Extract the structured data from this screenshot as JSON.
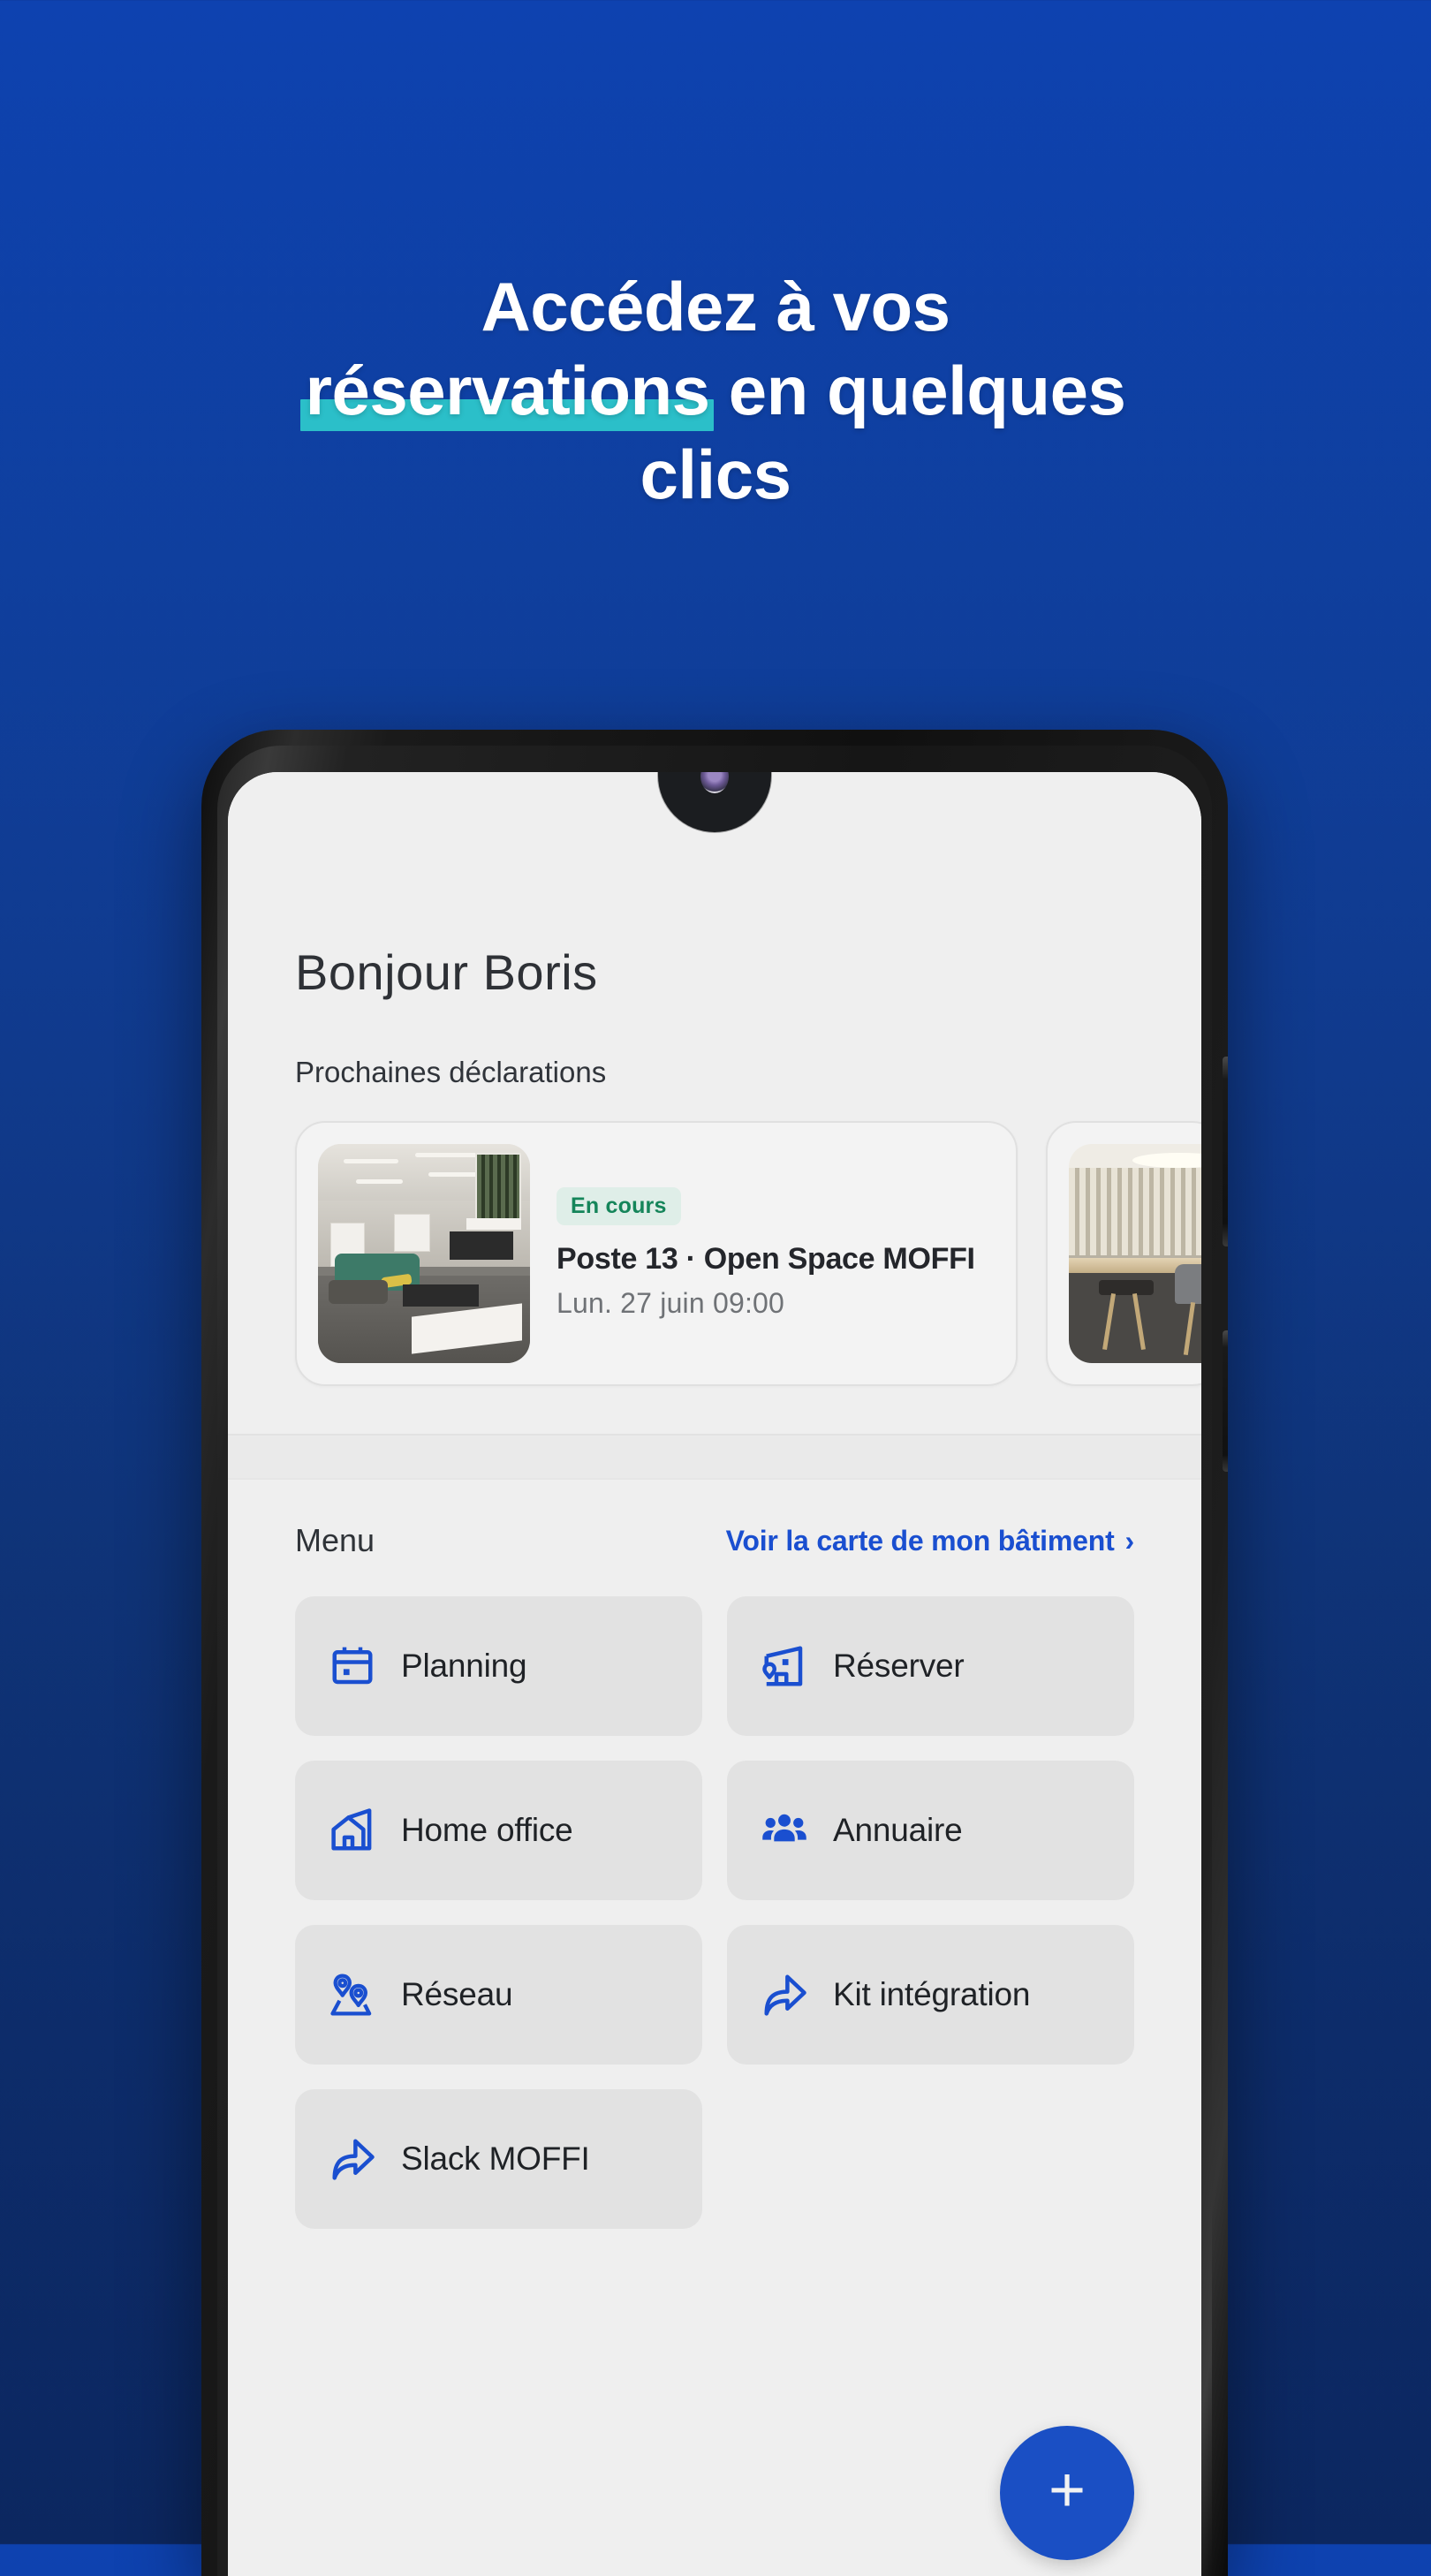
{
  "promo": {
    "headline_line1": "Accédez à vos",
    "headline_line2_highlight": "réservations",
    "headline_line2_rest": " en quelques",
    "headline_line3": "clics",
    "highlight_color": "#2bbfc9",
    "background_top": "#0e42b0",
    "background_bottom": "#0c2760"
  },
  "app": {
    "greeting": "Bonjour Boris",
    "section_label": "Prochaines déclarations",
    "accent_color": "#1a4fd0",
    "bookings": [
      {
        "status": "En cours",
        "status_text_color": "#15855a",
        "status_bg_color": "#dfeee8",
        "title": "Poste 13 · Open Space MOFFI",
        "datetime": "Lun. 27 juin 09:00",
        "thumb": "office-photo"
      },
      {
        "status": "",
        "title": "",
        "datetime": "",
        "thumb": "meeting-room-photo"
      }
    ],
    "menu": {
      "title": "Menu",
      "link_label": "Voir la carte de mon bâtiment",
      "link_chevron": "›",
      "items": [
        {
          "label": "Planning",
          "icon": "calendar-icon"
        },
        {
          "label": "Réserver",
          "icon": "floorplan-icon"
        },
        {
          "label": "Home office",
          "icon": "house-icon"
        },
        {
          "label": "Annuaire",
          "icon": "people-icon"
        },
        {
          "label": "Réseau",
          "icon": "map-pins-icon"
        },
        {
          "label": "Kit intégration",
          "icon": "share-arrow-icon"
        },
        {
          "label": "Slack MOFFI",
          "icon": "share-arrow-icon"
        }
      ]
    },
    "fab": {
      "label": "+",
      "color": "#1a4fc4"
    }
  }
}
